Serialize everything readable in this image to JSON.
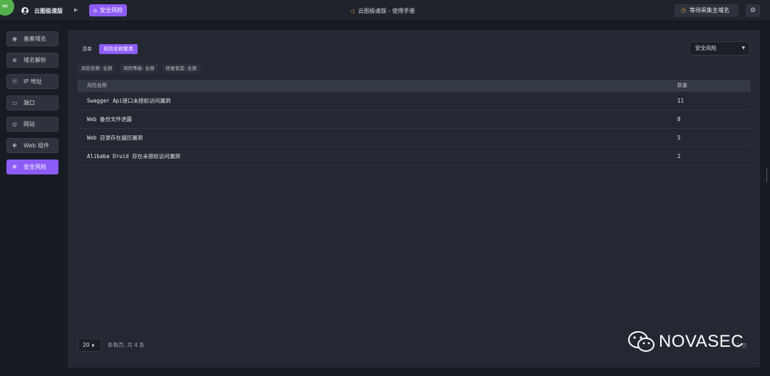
{
  "topbar": {
    "brand": "云图极速版",
    "breadcrumb_tag": "安全风险",
    "manual": "云图极速版 - 使用手册",
    "collect_button": "等待采集主域名"
  },
  "sidebar": {
    "items": [
      {
        "label": "备案域名",
        "icon": "record-icon"
      },
      {
        "label": "域名解析",
        "icon": "globe-icon"
      },
      {
        "label": "IP 地址",
        "icon": "ip-icon"
      },
      {
        "label": "端口",
        "icon": "monitor-icon"
      },
      {
        "label": "网站",
        "icon": "chrome-icon"
      },
      {
        "label": "Web 组件",
        "icon": "puzzle-icon"
      },
      {
        "label": "安全风险",
        "icon": "bug-icon",
        "active": true
      }
    ]
  },
  "tabs": {
    "list": "清单",
    "overview": "风险名称聚类"
  },
  "risk_select": {
    "value": "安全风险"
  },
  "filters": [
    "风险名称: 全部",
    "风险等级: 全部",
    "修复状态: 全部"
  ],
  "table": {
    "headers": {
      "name": "风险名称",
      "count": "数量"
    },
    "rows": [
      {
        "name": "Swagger Api接口未授权访问漏洞",
        "count": "11"
      },
      {
        "name": "Web 备份文件泄露",
        "count": "8"
      },
      {
        "name": "Web 目录存在遍历漏洞",
        "count": "5"
      },
      {
        "name": "Alibaba Druid 存在未授权访问漏洞",
        "count": "2"
      }
    ]
  },
  "pagination": {
    "page_size": "20",
    "info": "条每页, 共 4 条",
    "page": "1 页"
  },
  "watermark": {
    "text": "NOVASEC"
  },
  "colors": {
    "accent": "#8d5cf6",
    "background": "#171b23",
    "panel": "#232832",
    "logo_green": "#55b24a",
    "warning": "#e9a23b"
  }
}
